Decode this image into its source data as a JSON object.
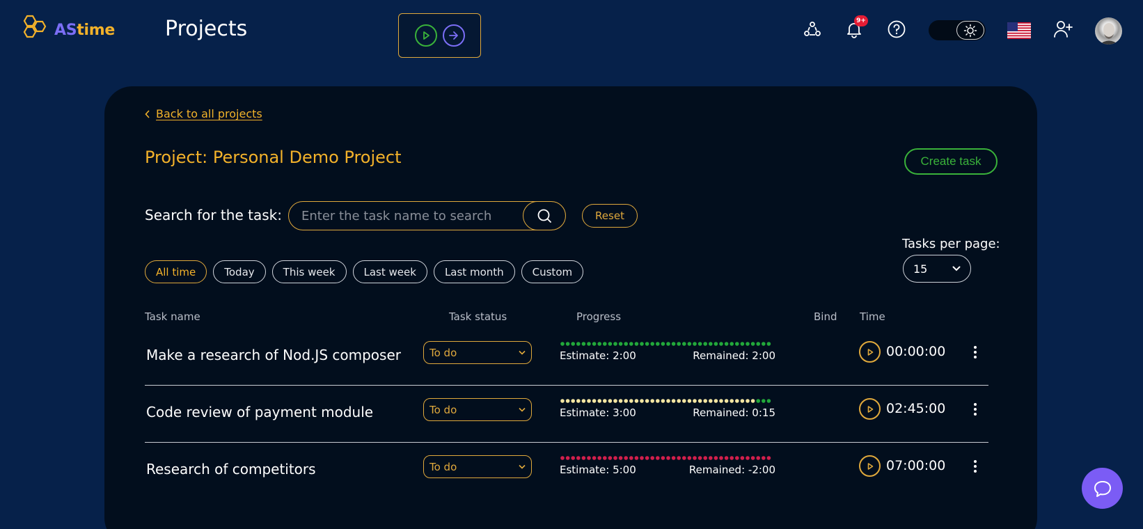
{
  "app": {
    "logo_prefix": "AS",
    "logo_suffix": "time",
    "page_title": "Projects"
  },
  "header": {
    "icons": [
      "team-icon",
      "bell-icon",
      "help-icon",
      "sun-icon",
      "us-flag-icon",
      "add-user-icon"
    ],
    "notification_badge": "9+"
  },
  "project": {
    "back_label": "Back to all projects",
    "title": "Project: Personal Demo Project",
    "create_task_label": "Create task"
  },
  "search": {
    "label": "Search for the task:",
    "placeholder": "Enter the task name to search",
    "value": "",
    "reset_label": "Reset"
  },
  "pagination": {
    "label": "Tasks per page:",
    "value": "15"
  },
  "filters": [
    {
      "label": "All time",
      "active": true
    },
    {
      "label": "Today",
      "active": false
    },
    {
      "label": "This week",
      "active": false
    },
    {
      "label": "Last week",
      "active": false
    },
    {
      "label": "Last month",
      "active": false
    },
    {
      "label": "Custom",
      "active": false
    }
  ],
  "table": {
    "headers": {
      "task_name": "Task name",
      "status": "Task status",
      "progress": "Progress",
      "bind": "Bind",
      "time": "Time"
    },
    "rows": [
      {
        "name": "Make a research of Nod.JS composer",
        "status": "To do",
        "estimate": "Estimate: 2:00",
        "remained": "Remained: 2:00",
        "progress_used_fraction": 0,
        "progress_state": "unused",
        "time": "00:00:00"
      },
      {
        "name": "Code review of payment module",
        "status": "To do",
        "estimate": "Estimate: 3:00",
        "remained": "Remained: 0:15",
        "progress_used_fraction": 0.92,
        "progress_state": "partial",
        "time": "02:45:00"
      },
      {
        "name": "Research of competitors",
        "status": "To do",
        "estimate": "Estimate: 5:00",
        "remained": "Remained: -2:00",
        "progress_used_fraction": 1,
        "progress_state": "over",
        "time": "07:00:00"
      }
    ]
  },
  "colors": {
    "background": "#06214a",
    "panel": "#020e1d",
    "accent": "#f3b22a",
    "green": "#3ab23a",
    "purple": "#7b6ef6",
    "progress_remaining": "#22a83a",
    "progress_used": "#f4e6a2",
    "progress_over": "#d21f4c"
  }
}
